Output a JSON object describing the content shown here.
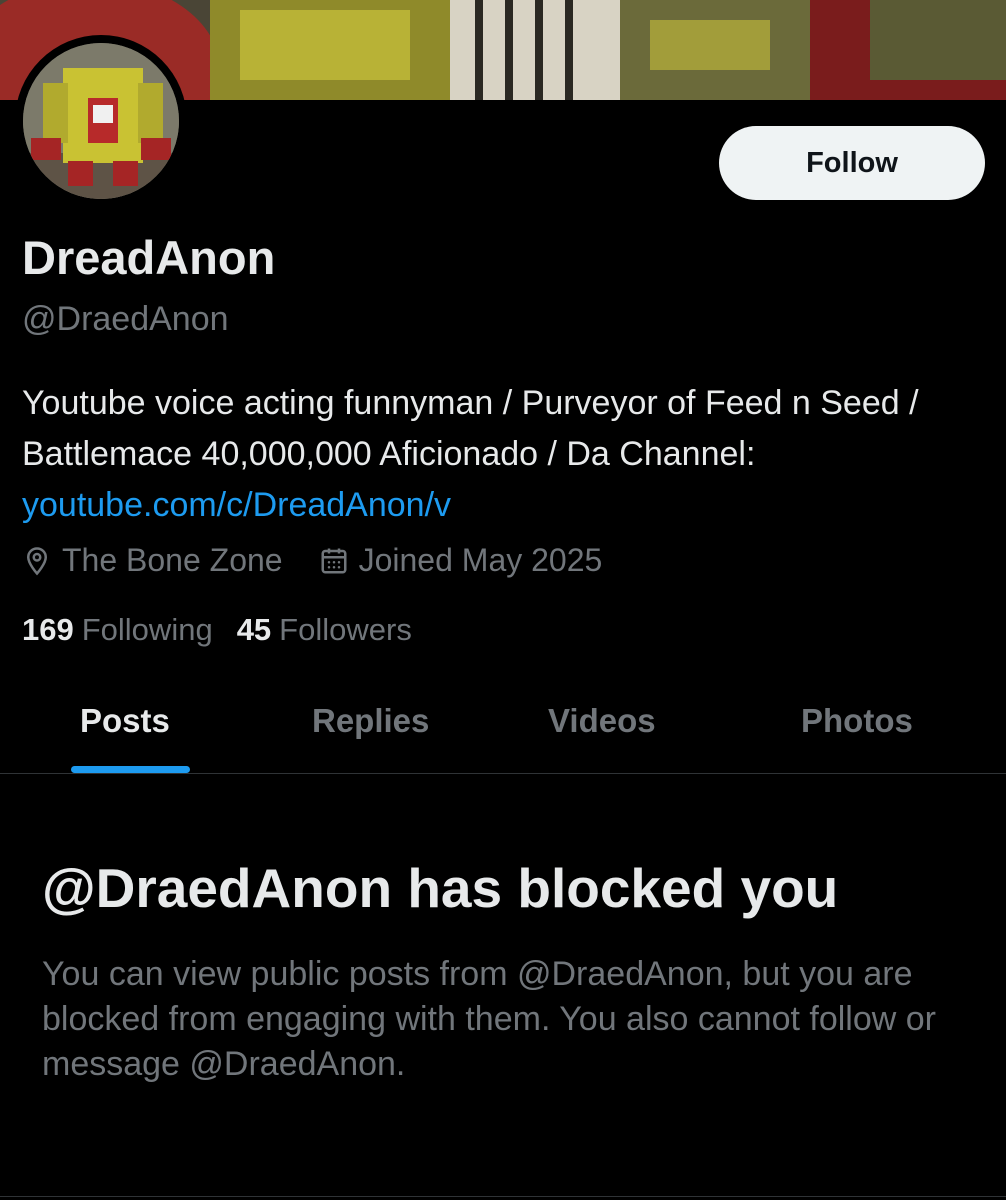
{
  "profile": {
    "display_name": "DreadAnon",
    "handle": "@DraedAnon",
    "follow_label": "Follow",
    "bio": {
      "text": "Youtube voice acting funnyman / Purveyor of Feed n Seed / Battlemace 40,000,000 Aficionado / Da Channel: ",
      "link": "youtube.com/c/DreadAnon/v"
    },
    "location": "The Bone Zone",
    "joined": "Joined May 2025",
    "following_count": "169",
    "following_label": "Following",
    "followers_count": "45",
    "followers_label": "Followers"
  },
  "tabs": [
    {
      "label": "Posts",
      "active": true
    },
    {
      "label": "Replies",
      "active": false
    },
    {
      "label": "Videos",
      "active": false
    },
    {
      "label": "Photos",
      "active": false
    }
  ],
  "blocked": {
    "title": "@DraedAnon has blocked you",
    "description": "You can view public posts from @DraedAnon, but you are blocked from engaging with them. You also cannot follow or message @DraedAnon."
  },
  "icons": {
    "location": "location-pin-icon",
    "calendar": "calendar-icon"
  },
  "colors": {
    "accent": "#1d9bf0",
    "muted": "#71767b",
    "text": "#e7e9ea",
    "background": "#000000"
  }
}
